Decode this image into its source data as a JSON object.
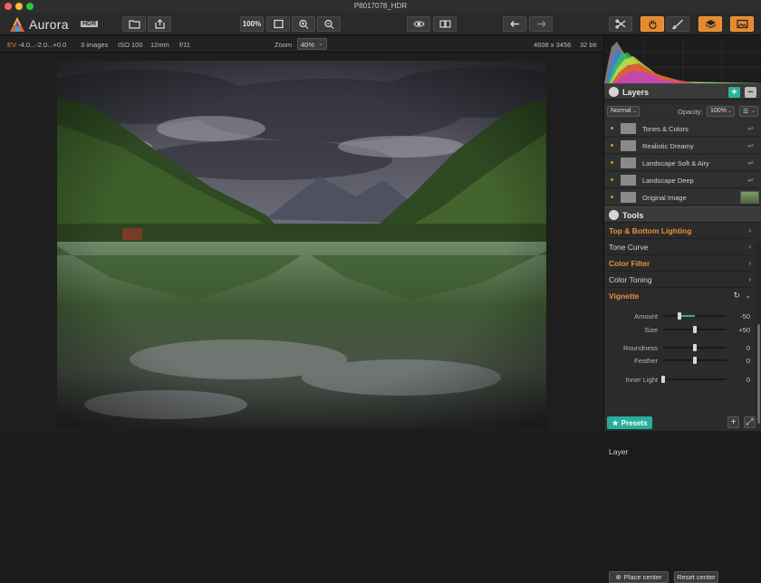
{
  "window": {
    "title": "P8017078_HDR"
  },
  "app": {
    "brand": "Aurora",
    "badge": "HDR"
  },
  "toolbar": {
    "zoom_100_label": "100%",
    "icons": [
      "folder-open-icon",
      "share-icon",
      "fit-screen-icon",
      "zoom-in-icon",
      "zoom-out-icon",
      "eye-icon",
      "compare-icon",
      "undo-icon",
      "redo-icon",
      "crop-icon",
      "hand-tool-icon",
      "brush-icon",
      "layers-icon",
      "image-icon"
    ]
  },
  "infobar": {
    "ev_prefix": "EV",
    "ev_values": "-4.0...-2.0...+0.0",
    "images": "3 images",
    "iso": "ISO 100",
    "focal": "12mm",
    "aperture": "f/11",
    "zoom_label": "Zoom",
    "zoom_value": "40%",
    "dimensions": "4608 x 3456",
    "bit_depth": "32 bit"
  },
  "layers": {
    "title": "Layers",
    "blend_mode": "Normal",
    "opacity_label": "Opacity:",
    "opacity_value": "100%",
    "items": [
      {
        "name": "Tones & Colors"
      },
      {
        "name": "Realistic Dreamy"
      },
      {
        "name": "Landscape Soft & Airy"
      },
      {
        "name": "Landscape Deep"
      },
      {
        "name": "Original Image"
      }
    ]
  },
  "tools": {
    "title": "Tools",
    "rows": [
      {
        "name": "Top & Bottom Lighting",
        "accent": true
      },
      {
        "name": "Tone Curve",
        "accent": false
      },
      {
        "name": "Color Filter",
        "accent": true
      },
      {
        "name": "Color Toning",
        "accent": false
      },
      {
        "name": "Vignette",
        "accent": true
      }
    ],
    "vignette": {
      "sliders": [
        {
          "label": "Amount",
          "value": "-50",
          "fraction": 0.25,
          "bipolar": true
        },
        {
          "label": "Size",
          "value": "+50",
          "fraction": 0.5,
          "bipolar": false
        },
        {
          "label": "Roundness",
          "value": "0",
          "fraction": 0.5,
          "bipolar": false
        },
        {
          "label": "Feather",
          "value": "0",
          "fraction": 0.5,
          "bipolar": false
        },
        {
          "label": "Inner Light",
          "value": "0",
          "fraction": 0.0,
          "bipolar": false
        }
      ],
      "place_center_label": "Place center",
      "reset_center_label": "Reset center"
    },
    "next_section_label": "Layer"
  },
  "footer": {
    "presets_label": "Presets"
  },
  "colors": {
    "accent_orange": "#e58a2e",
    "accent_teal": "#27ae9b"
  }
}
